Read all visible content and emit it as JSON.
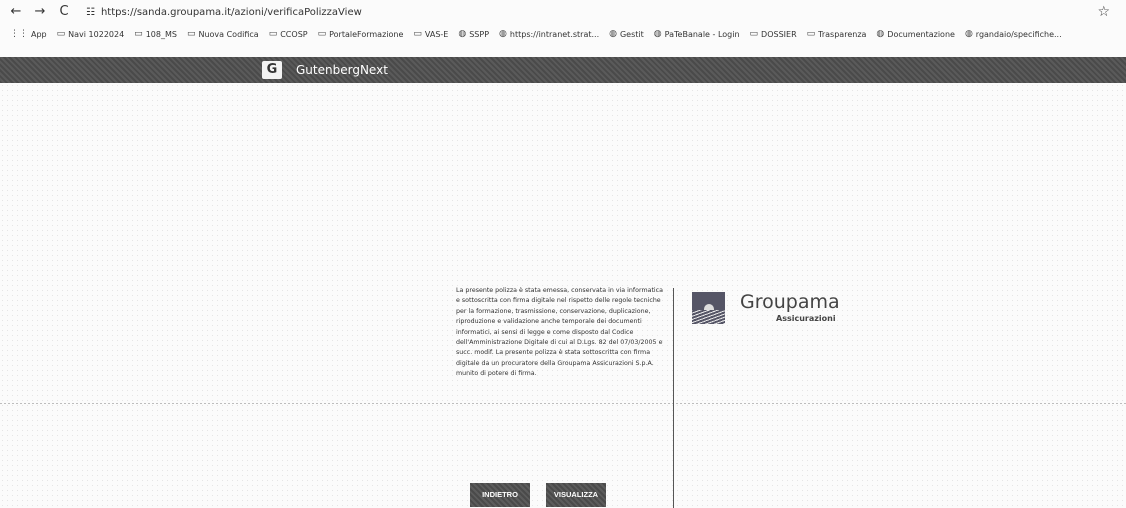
{
  "browser": {
    "url": "https://sanda.groupama.it/azioni/verificaPolizzaView",
    "nav": {
      "back": "←",
      "forward": "→",
      "reload": "C"
    },
    "bookmarks": [
      {
        "label": "App",
        "icon": "apps-icon"
      },
      {
        "label": "Navi 1022024",
        "icon": "folder-icon"
      },
      {
        "label": "108_MS",
        "icon": "folder-icon"
      },
      {
        "label": "Nuova Codifica",
        "icon": "folder-icon"
      },
      {
        "label": "CCOSP",
        "icon": "folder-icon"
      },
      {
        "label": "PortaleFormazione",
        "icon": "folder-icon"
      },
      {
        "label": "VAS-E",
        "icon": "folder-icon"
      },
      {
        "label": "SSPP",
        "icon": "globe-icon"
      },
      {
        "label": "https://intranet.strat...",
        "icon": "globe-icon"
      },
      {
        "label": "Gestit",
        "icon": "globe-icon"
      },
      {
        "label": "PaTeBanale - Login",
        "icon": "globe-icon"
      },
      {
        "label": "DOSSIER",
        "icon": "folder-icon"
      },
      {
        "label": "Trasparenza",
        "icon": "folder-icon"
      },
      {
        "label": "Documentazione",
        "icon": "globe-icon"
      },
      {
        "label": "rgandaio/specifiche...",
        "icon": "globe-icon"
      }
    ]
  },
  "app": {
    "name": "GutenbergNext",
    "logo": "G"
  },
  "info_text": "La presente polizza è stata emessa, conservata in via informatica e sottoscritta con firma digitale nel rispetto delle regole tecniche per la formazione, trasmissione, conservazione, duplicazione, riproduzione e validazione anche temporale dei documenti informatici, ai sensi di legge e come disposto dal Codice dell'Amministrazione Digitale di cui al D.Lgs. 82 del 07/03/2005 e succ. modif. La presente polizza è stata sottoscritta con firma digitale da un procuratore della Groupama Assicurazioni S.p.A. munito di potere di firma.",
  "brand": {
    "name": "Groupama",
    "subtitle": "Assicurazioni"
  },
  "buttons": {
    "back": "INDIETRO",
    "view": "VISUALIZZA"
  }
}
